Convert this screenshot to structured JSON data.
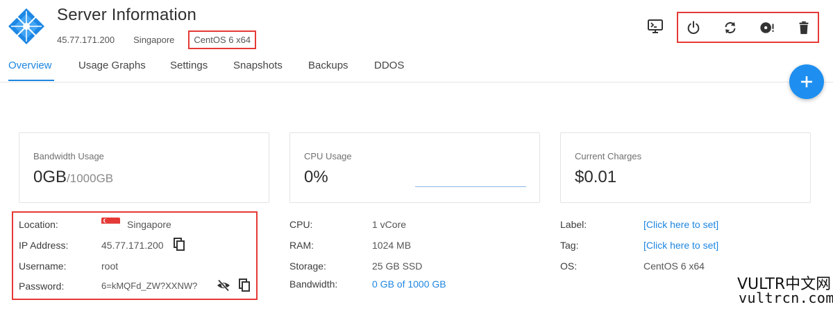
{
  "header": {
    "title": "Server Information",
    "ip": "45.77.171.200",
    "region": "Singapore",
    "os": "CentOS 6 x64"
  },
  "actions": [
    {
      "name": "console",
      "icon": "console-icon"
    },
    {
      "name": "power",
      "icon": "power-icon"
    },
    {
      "name": "restart",
      "icon": "restart-icon"
    },
    {
      "name": "reinstall",
      "icon": "reinstall-icon"
    },
    {
      "name": "destroy",
      "icon": "trash-icon"
    }
  ],
  "tabs": [
    "Overview",
    "Usage Graphs",
    "Settings",
    "Snapshots",
    "Backups",
    "DDOS"
  ],
  "cards": {
    "bandwidth": {
      "label": "Bandwidth Usage",
      "value": "0GB",
      "suffix": "/1000GB"
    },
    "cpu": {
      "label": "CPU Usage",
      "value": "0%"
    },
    "charges": {
      "label": "Current Charges",
      "value": "$0.01"
    }
  },
  "details_left": {
    "location": {
      "label": "Location:",
      "value": "Singapore"
    },
    "ip": {
      "label": "IP Address:",
      "value": "45.77.171.200"
    },
    "username": {
      "label": "Username:",
      "value": "root"
    },
    "password": {
      "label": "Password:",
      "value": "6=kMQFd_ZW?XXNW?"
    }
  },
  "details_mid": {
    "cpu": {
      "label": "CPU:",
      "value": "1 vCore"
    },
    "ram": {
      "label": "RAM:",
      "value": "1024 MB"
    },
    "storage": {
      "label": "Storage:",
      "value": "25 GB SSD"
    },
    "bandwidth": {
      "label": "Bandwidth:",
      "value": "0 GB of 1000 GB"
    }
  },
  "details_right": {
    "label": {
      "label": "Label:",
      "value": "[Click here to set]"
    },
    "tag": {
      "label": "Tag:",
      "value": "[Click here to set]"
    },
    "os": {
      "label": "OS:",
      "value": "CentOS 6 x64"
    }
  },
  "watermark": {
    "line1": "VULTR中文网",
    "line2": "vultrcn.com"
  },
  "colors": {
    "accent": "#1d86e0",
    "highlight": "#e53935",
    "logo": "#1e88e5"
  }
}
